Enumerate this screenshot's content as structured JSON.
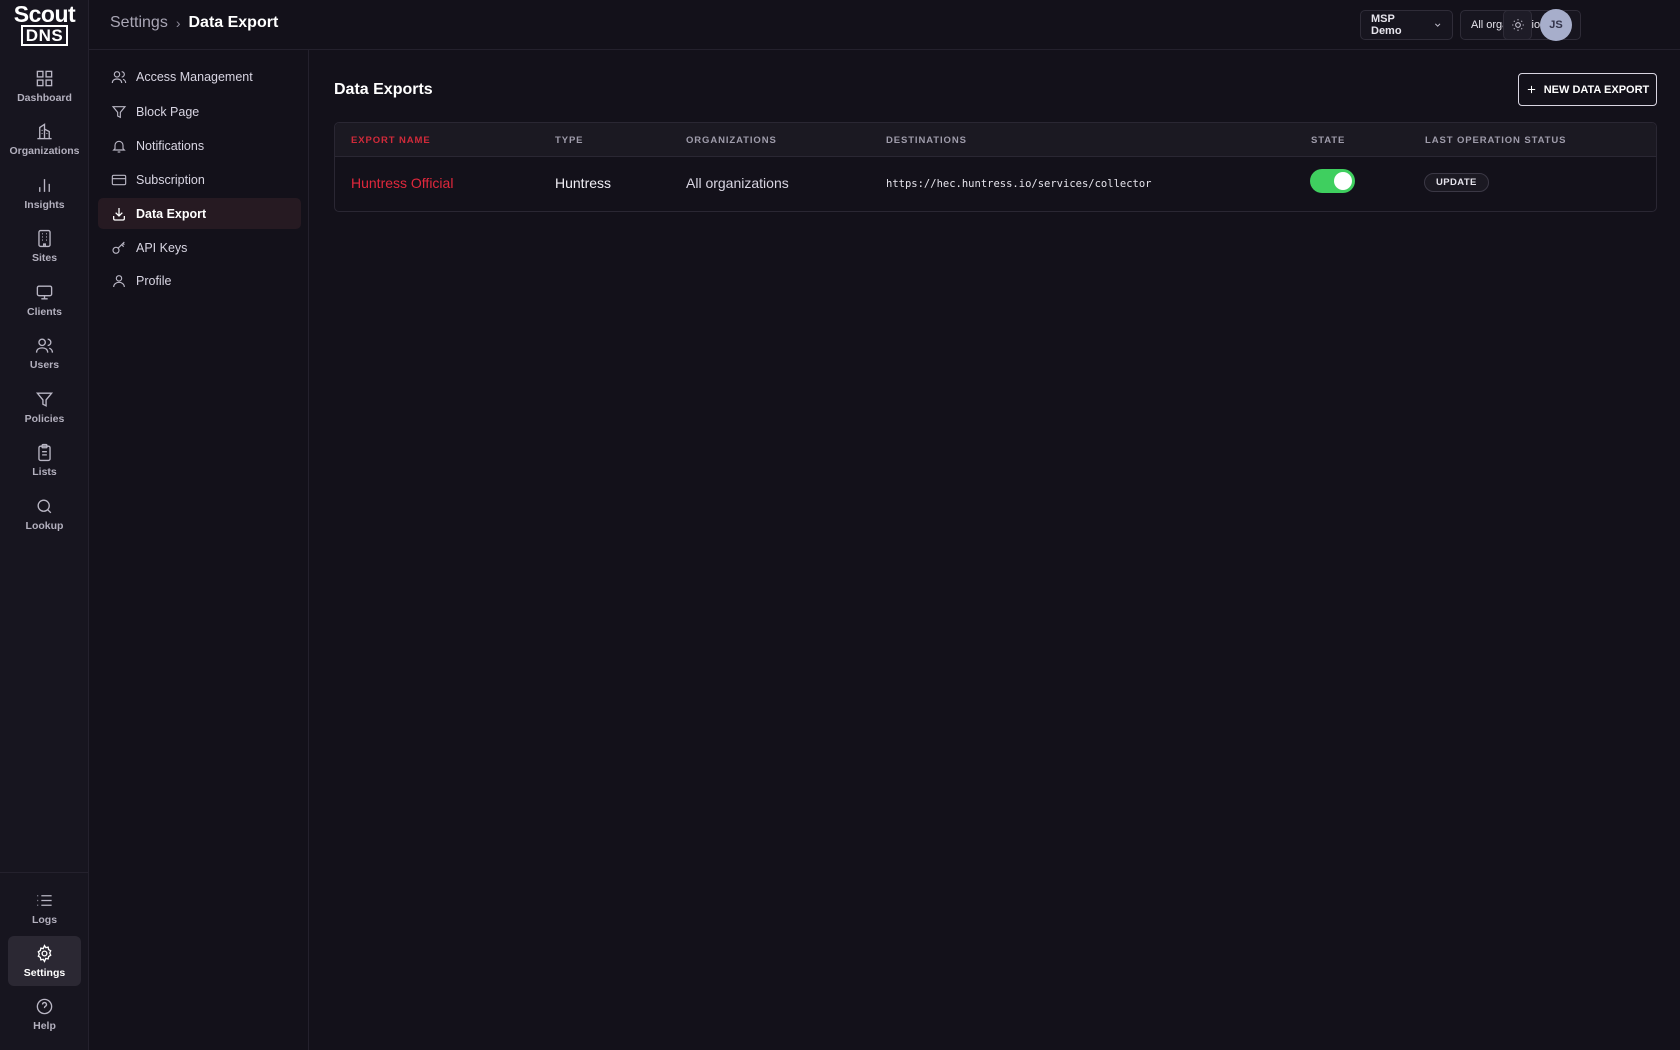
{
  "logo": {
    "line1": "Scout",
    "line2": "DNS"
  },
  "rail": {
    "items": [
      {
        "label": "Dashboard"
      },
      {
        "label": "Organizations"
      },
      {
        "label": "Insights"
      },
      {
        "label": "Sites"
      },
      {
        "label": "Clients"
      },
      {
        "label": "Users"
      },
      {
        "label": "Policies"
      },
      {
        "label": "Lists"
      },
      {
        "label": "Lookup"
      }
    ],
    "bottom": [
      {
        "label": "Logs"
      },
      {
        "label": "Settings"
      },
      {
        "label": "Help"
      }
    ]
  },
  "header": {
    "breadcrumb": {
      "parent": "Settings",
      "separator": "›",
      "current": "Data Export"
    },
    "msp_select": "MSP Demo",
    "org_select": "All organizations",
    "avatar_initials": "JS"
  },
  "settings_nav": {
    "items": [
      {
        "label": "Access Management"
      },
      {
        "label": "Block Page"
      },
      {
        "label": "Notifications"
      },
      {
        "label": "Subscription"
      },
      {
        "label": "Data Export"
      },
      {
        "label": "API Keys"
      },
      {
        "label": "Profile"
      }
    ]
  },
  "main": {
    "title": "Data Exports",
    "new_button": "NEW DATA EXPORT",
    "table": {
      "columns": [
        "EXPORT NAME",
        "TYPE",
        "ORGANIZATIONS",
        "DESTINATIONS",
        "STATE",
        "LAST OPERATION STATUS"
      ],
      "rows": [
        {
          "name": "Huntress Official",
          "type": "Huntress",
          "organizations": "All organizations",
          "destination": "https://hec.huntress.io/services/collector",
          "state_enabled": true,
          "status": "UPDATE"
        }
      ]
    }
  },
  "colors": {
    "accent_red": "#e0283c",
    "toggle_on": "#3fcf5f",
    "background": "#13111a"
  }
}
